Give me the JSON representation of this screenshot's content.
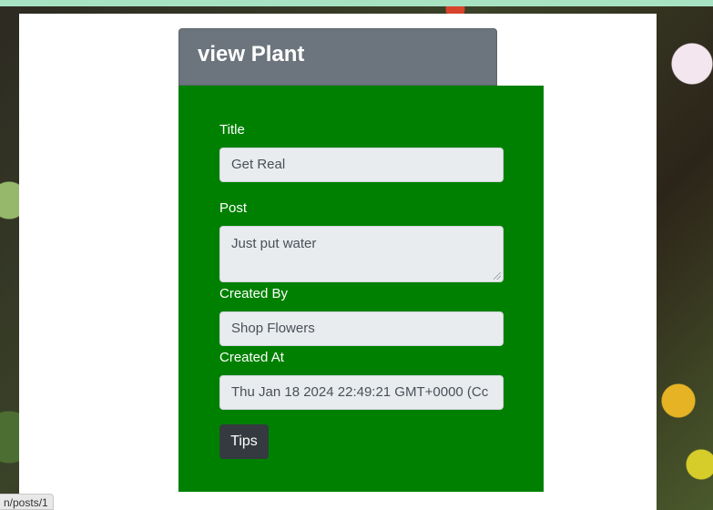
{
  "card": {
    "title": "view Plant"
  },
  "form": {
    "title_label": "Title",
    "title_value": "Get Real",
    "post_label": "Post",
    "post_value": "Just put water",
    "created_by_label": "Created By",
    "created_by_value": "Shop Flowers",
    "created_at_label": "Created At",
    "created_at_value": "Thu Jan 18 2024 22:49:21 GMT+0000 (Cc",
    "tips_label": "Tips"
  },
  "status_bar": {
    "url": "n/posts/1"
  },
  "colors": {
    "header": "#6c757d",
    "body": "#008000",
    "field": "#e9ecef",
    "button": "#343a40"
  }
}
